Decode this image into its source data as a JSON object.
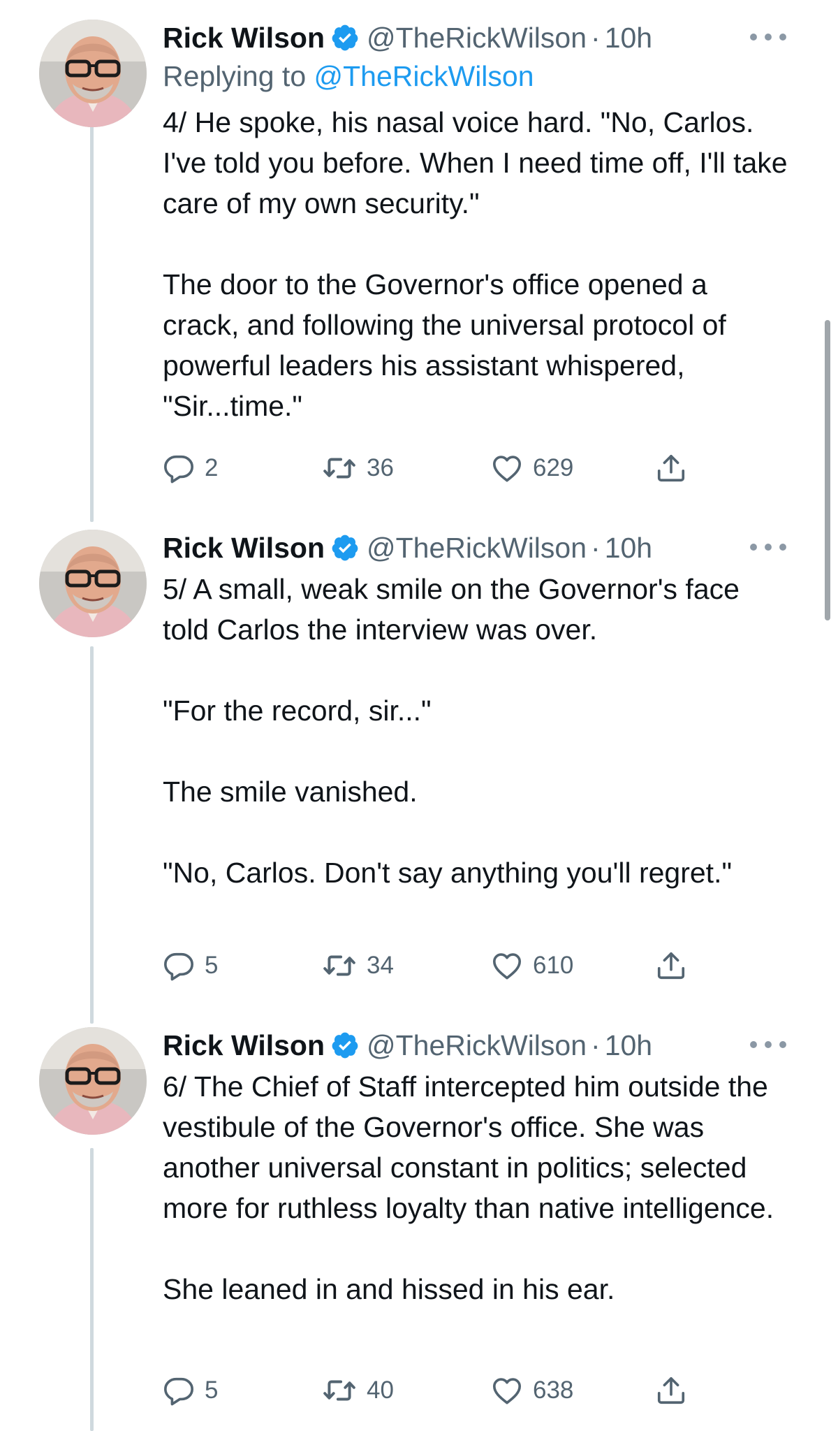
{
  "colors": {
    "text": "#0f1419",
    "secondary": "#536471",
    "link": "#1d9bf0",
    "verified": "#1d9bf0",
    "thread_line": "#cfd9de"
  },
  "tweets": [
    {
      "name": "Rick Wilson",
      "handle": "@TheRickWilson",
      "separator": "·",
      "time": "10h",
      "replying_prefix": "Replying to ",
      "replying_handle": "@TheRickWilson",
      "text": "4/ He spoke, his nasal voice hard. \"No, Carlos. I've told you before. When I need time off, I'll take care of my own security.\"\n\nThe door to the Governor's office opened a crack, and following the universal protocol of powerful leaders his assistant whispered, \"Sir...time.\"",
      "replies": "2",
      "retweets": "36",
      "likes": "629"
    },
    {
      "name": "Rick Wilson",
      "handle": "@TheRickWilson",
      "separator": "·",
      "time": "10h",
      "text": "5/ A small, weak smile on the Governor's face told Carlos the interview was over.\n\n\"For the record, sir...\"\n\nThe smile vanished.\n\n\"No, Carlos. Don't say anything you'll regret.\"",
      "replies": "5",
      "retweets": "34",
      "likes": "610"
    },
    {
      "name": "Rick Wilson",
      "handle": "@TheRickWilson",
      "separator": "·",
      "time": "10h",
      "text": "6/ The Chief of Staff intercepted him outside the vestibule of the Governor's office.  She was another universal constant in politics; selected more for ruthless loyalty than native intelligence.\n\nShe leaned in and hissed in his ear.",
      "replies": "5",
      "retweets": "40",
      "likes": "638"
    }
  ]
}
